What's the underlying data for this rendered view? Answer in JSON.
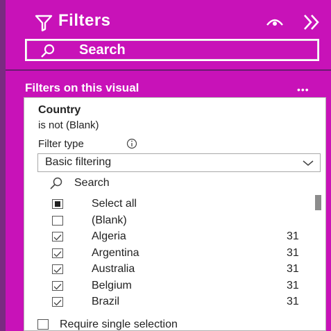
{
  "pane": {
    "title": "Filters",
    "search_placeholder": "Search",
    "section_label": "Filters on this visual",
    "more_label": "•••"
  },
  "card": {
    "field_name": "Country",
    "condition": "is not (Blank)",
    "filter_type_label": "Filter type",
    "filter_type_value": "Basic filtering",
    "search_placeholder": "Search",
    "items": [
      {
        "label": "Select all",
        "count": "",
        "state": "partial"
      },
      {
        "label": "(Blank)",
        "count": "",
        "state": "unchecked"
      },
      {
        "label": "Algeria",
        "count": "31",
        "state": "checked"
      },
      {
        "label": "Argentina",
        "count": "31",
        "state": "checked"
      },
      {
        "label": "Australia",
        "count": "31",
        "state": "checked"
      },
      {
        "label": "Belgium",
        "count": "31",
        "state": "checked"
      },
      {
        "label": "Brazil",
        "count": "31",
        "state": "checked"
      }
    ],
    "require_single_label": "Require single selection"
  },
  "colors": {
    "pane_bg": "#c812b8",
    "pane_edge": "#7b2a82",
    "text_light": "#ffffff"
  },
  "icons": [
    "filter-icon",
    "eye-icon",
    "collapse-icon",
    "search-icon",
    "info-icon",
    "chevron-down-icon",
    "checkbox-icon"
  ]
}
